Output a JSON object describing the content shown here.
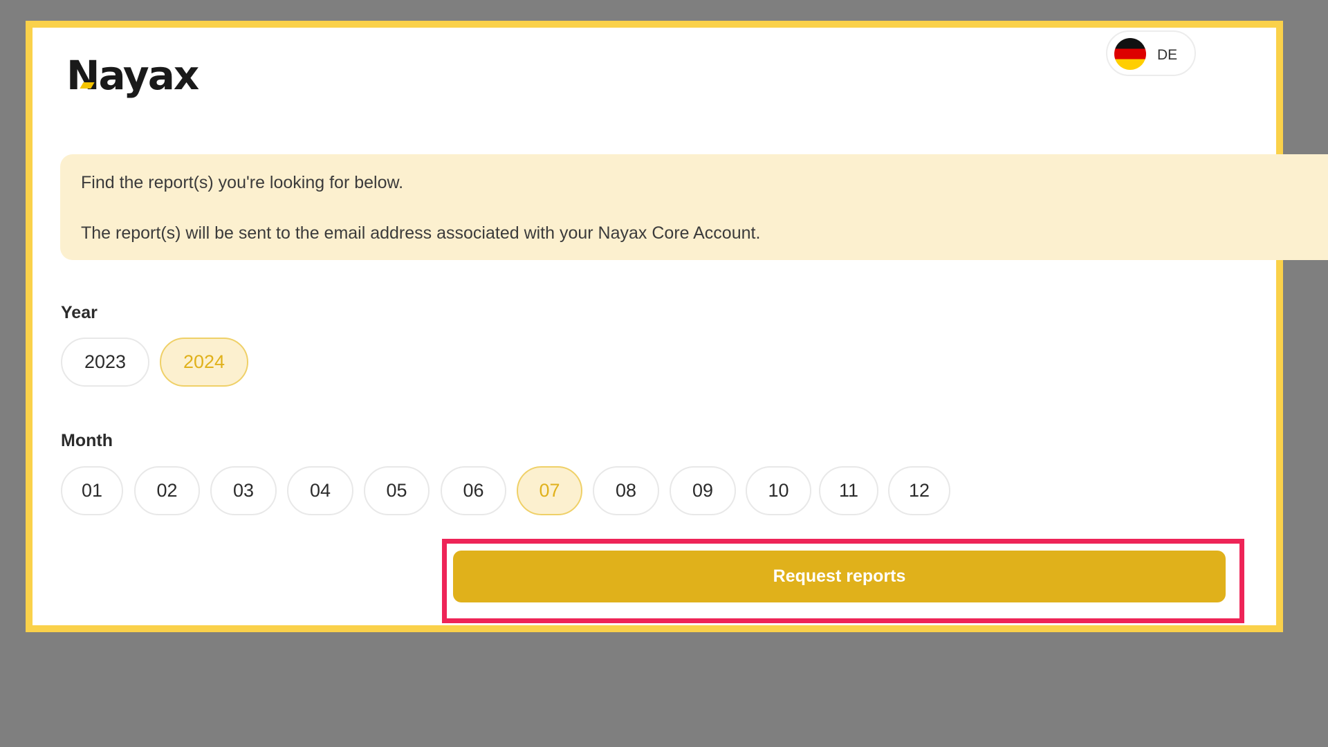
{
  "brand": {
    "logo_text": "Nayax",
    "accent_color": "#fad14a",
    "button_color": "#e0b11b"
  },
  "language": {
    "code": "DE",
    "flag_icon": "germany-flag-icon"
  },
  "info": {
    "line1": "Find the report(s) you're looking for below.",
    "line2": "The report(s) will be sent to the email address associated with your Nayax Core Account."
  },
  "year": {
    "label": "Year",
    "options": [
      "2023",
      "2024"
    ],
    "selected": "2024"
  },
  "month": {
    "label": "Month",
    "options": [
      "01",
      "02",
      "03",
      "04",
      "05",
      "06",
      "07",
      "08",
      "09",
      "10",
      "11",
      "12"
    ],
    "selected": "07"
  },
  "actions": {
    "request_label": "Request reports"
  },
  "annotation": {
    "highlight_color": "#ee2457"
  }
}
